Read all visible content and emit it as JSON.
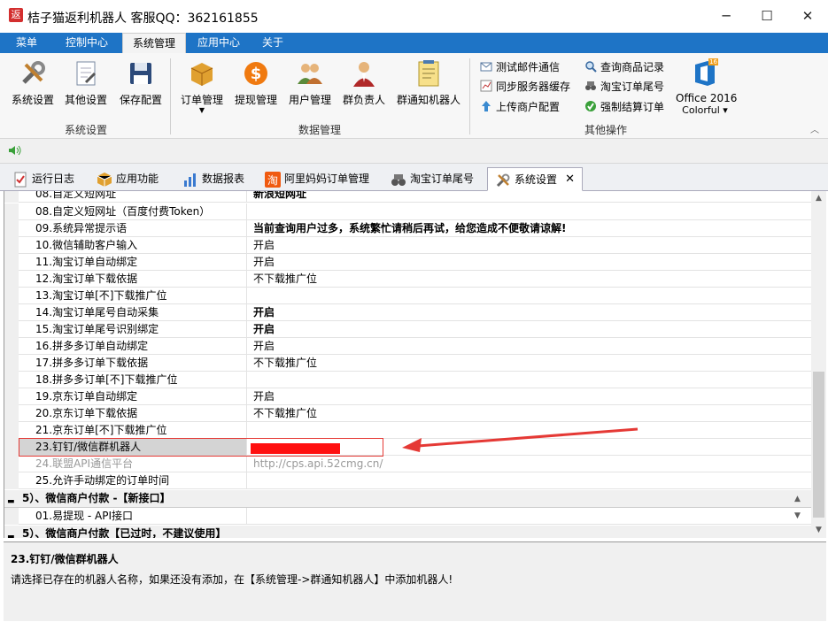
{
  "window": {
    "icon_char": "返",
    "title": "桔子猫返利机器人 客服QQ：362161855",
    "minimize": "─",
    "maximize": "☐",
    "close": "✕"
  },
  "menubar": {
    "items": [
      "菜单",
      "控制中心",
      "系统管理",
      "应用中心",
      "关于"
    ]
  },
  "ribbon": {
    "sys_settings_group": {
      "label": "系统设置",
      "buttons": [
        "系统设置",
        "其他设置",
        "保存配置"
      ]
    },
    "data_group": {
      "label": "数据管理",
      "buttons": [
        "订单管理",
        "提现管理",
        "用户管理",
        "群负责人",
        "群通知机器人"
      ]
    },
    "other_group": {
      "label": "其他操作",
      "col1": [
        "测试邮件通信",
        "同步服务器缓存",
        "上传商户配置"
      ],
      "col2": [
        "查询商品记录",
        "淘宝订单尾号",
        "强制结算订单"
      ]
    },
    "office": {
      "line1": "Office 2016",
      "line2": "Colorful ▾",
      "badge": "16"
    }
  },
  "tabs": [
    "运行日志",
    "应用功能",
    "数据报表",
    "阿里妈妈订单管理",
    "淘宝订单尾号",
    "系统设置"
  ],
  "grid": {
    "rows": [
      {
        "name": "08.自定义短网址",
        "value": "新浪短网址",
        "bold": true
      },
      {
        "name": "08.自定义短网址（百度付费Token）",
        "value": ""
      },
      {
        "name": "09.系统异常提示语",
        "value": "当前查询用户过多，系统繁忙请稍后再试，给您造成不便敬请谅解!",
        "bold": true
      },
      {
        "name": "10.微信辅助客户输入",
        "value": "开启"
      },
      {
        "name": "11.淘宝订单自动绑定",
        "value": "开启"
      },
      {
        "name": "12.淘宝订单下载依据",
        "value": "不下载推广位"
      },
      {
        "name": "13.淘宝订单[不]下载推广位",
        "value": ""
      },
      {
        "name": "14.淘宝订单尾号自动采集",
        "value": "开启",
        "bold": true
      },
      {
        "name": "15.淘宝订单尾号识别绑定",
        "value": "开启",
        "bold": true
      },
      {
        "name": "16.拼多多订单自动绑定",
        "value": "开启"
      },
      {
        "name": "17.拼多多订单下载依据",
        "value": "不下载推广位"
      },
      {
        "name": "18.拼多多订单[不]下载推广位",
        "value": ""
      },
      {
        "name": "19.京东订单自动绑定",
        "value": "开启"
      },
      {
        "name": "20.京东订单下载依据",
        "value": "不下载推广位"
      },
      {
        "name": "21.京东订单[不]下载推广位",
        "value": ""
      },
      {
        "name": "23.钉钉/微信群机器人",
        "value": "",
        "selected": true
      },
      {
        "name": "24.联盟API通信平台",
        "value": "http://cps.api.52cmg.cn/",
        "disabled": true
      },
      {
        "name": "25.允许手动绑定的订单时间",
        "value": ""
      }
    ],
    "cat5": "5）、微信商户付款 -【新接口】",
    "row_api": {
      "name": "01.易提现 - API接口",
      "value": ""
    },
    "cat5_old": "5）、微信商户付款【已过时，不建议使用】"
  },
  "description": {
    "title": "23.钉钉/微信群机器人",
    "text": "请选择已存在的机器人名称，如果还没有添加，在【系统管理->群通知机器人】中添加机器人!"
  },
  "colors": {
    "menubar": "#1e74c6",
    "highlight": "#e53935"
  }
}
